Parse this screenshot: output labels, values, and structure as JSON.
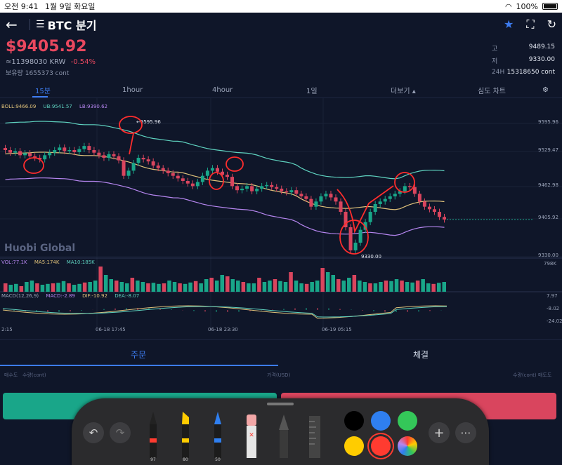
{
  "status_bar": {
    "time": "오전 9:41",
    "date": "1월 9일 화요일",
    "battery": "100%"
  },
  "header": {
    "back_icon": "arrow-left-icon",
    "title": "BTC 분기",
    "icons": [
      "star-icon",
      "fullscreen-icon",
      "share-icon"
    ]
  },
  "price": {
    "main": "$9405.92",
    "krw": "≈11398030 KRW",
    "change": "-0.54%",
    "holdings_label": "보유량",
    "holdings_value": "1655373 cont"
  },
  "stats": {
    "high_label": "고",
    "high_value": "9489.15",
    "low_label": "저",
    "low_value": "9330.00",
    "vol_label": "24H",
    "vol_value": "15318650 cont"
  },
  "tabs": {
    "t1": "15분",
    "t2": "1hour",
    "t3": "4hour",
    "t4": "1일",
    "t5": "더보기 ▴",
    "t6": "심도 차트"
  },
  "indicators": {
    "boll": "BOLL:9466.09",
    "ub": "UB:9541.57",
    "lb": "LB:9390.62",
    "vol": "VOL:77.1K",
    "ma5": "MA5:174K",
    "ma10": "MA10:185K",
    "macd": "MACD(12,26,9)",
    "macd_val": "MACD:-2.89",
    "dif": "DIF:-10.92",
    "dea": "DEA:-8.07"
  },
  "watermark": "Huobi Global",
  "chart_data": {
    "type": "candlestick",
    "y_ticks": [
      "9595.96",
      "9529.47",
      "9462.98",
      "9405.92",
      "9330.00"
    ],
    "volume_ticks": [
      "798K"
    ],
    "macd_ticks": [
      "7.97",
      "-8.02",
      "-24.02"
    ],
    "x_ticks": [
      "2:15",
      "06-18 17:45",
      "06-18 23:30",
      "06-19 05:15"
    ],
    "annotations": {
      "high": "9595.96",
      "low": "9330.00"
    },
    "ylim": [
      9330,
      9600
    ],
    "closes": [
      9540,
      9535,
      9538,
      9530,
      9534,
      9528,
      9525,
      9522,
      9530,
      9535,
      9540,
      9545,
      9538,
      9540,
      9536,
      9542,
      9548,
      9540,
      9535,
      9530,
      9525,
      9532,
      9528,
      9520,
      9490,
      9500,
      9515,
      9525,
      9522,
      9518,
      9510,
      9505,
      9500,
      9495,
      9490,
      9485,
      9480,
      9475,
      9470,
      9478,
      9490,
      9500,
      9505,
      9498,
      9492,
      9488,
      9470,
      9462,
      9465,
      9470,
      9460,
      9465,
      9470,
      9472,
      9468,
      9465,
      9460,
      9458,
      9462,
      9455,
      9450,
      9445,
      9430,
      9440,
      9450,
      9455,
      9448,
      9440,
      9420,
      9390,
      9345,
      9360,
      9385,
      9400,
      9420,
      9435,
      9440,
      9445,
      9450,
      9455,
      9460,
      9470,
      9468,
      9455,
      9440,
      9430,
      9425,
      9420,
      9410,
      9405
    ],
    "volumes": [
      30,
      25,
      28,
      20,
      35,
      40,
      30,
      25,
      28,
      30,
      32,
      38,
      30,
      25,
      28,
      33,
      35,
      40,
      90,
      60,
      45,
      40,
      35,
      30,
      50,
      40,
      35,
      30,
      32,
      28,
      30,
      40,
      35,
      30,
      28,
      33,
      38,
      30,
      45,
      50,
      40,
      60,
      55,
      45,
      40,
      35,
      30,
      30,
      50,
      35,
      40,
      45,
      38,
      35,
      70,
      40,
      30,
      28,
      35,
      40,
      85,
      70,
      60,
      45,
      40,
      50,
      60,
      40,
      35,
      30,
      30,
      35,
      40,
      38,
      45,
      40,
      35,
      33,
      40,
      45,
      30,
      28,
      32,
      35
    ]
  },
  "bottom_tabs": {
    "order": "주문",
    "trades": "체결"
  },
  "order_header": {
    "side": "매수도",
    "qty": "수량(cont)",
    "price": "가격(USD)",
    "qty_right": "수량(cont)",
    "side_right": "매도도"
  },
  "toolbar": {
    "undo_icon": "undo-icon",
    "redo_icon": "redo-icon",
    "pen1_label": "97",
    "pen2_label": "80",
    "pen3_label": "50",
    "add_icon": "plus-icon",
    "more_icon": "more-icon",
    "colors": [
      "#000000",
      "#2f7ff0",
      "#34c759",
      "#ffcc00",
      "#ff3b30",
      "#d9d9d9"
    ]
  }
}
